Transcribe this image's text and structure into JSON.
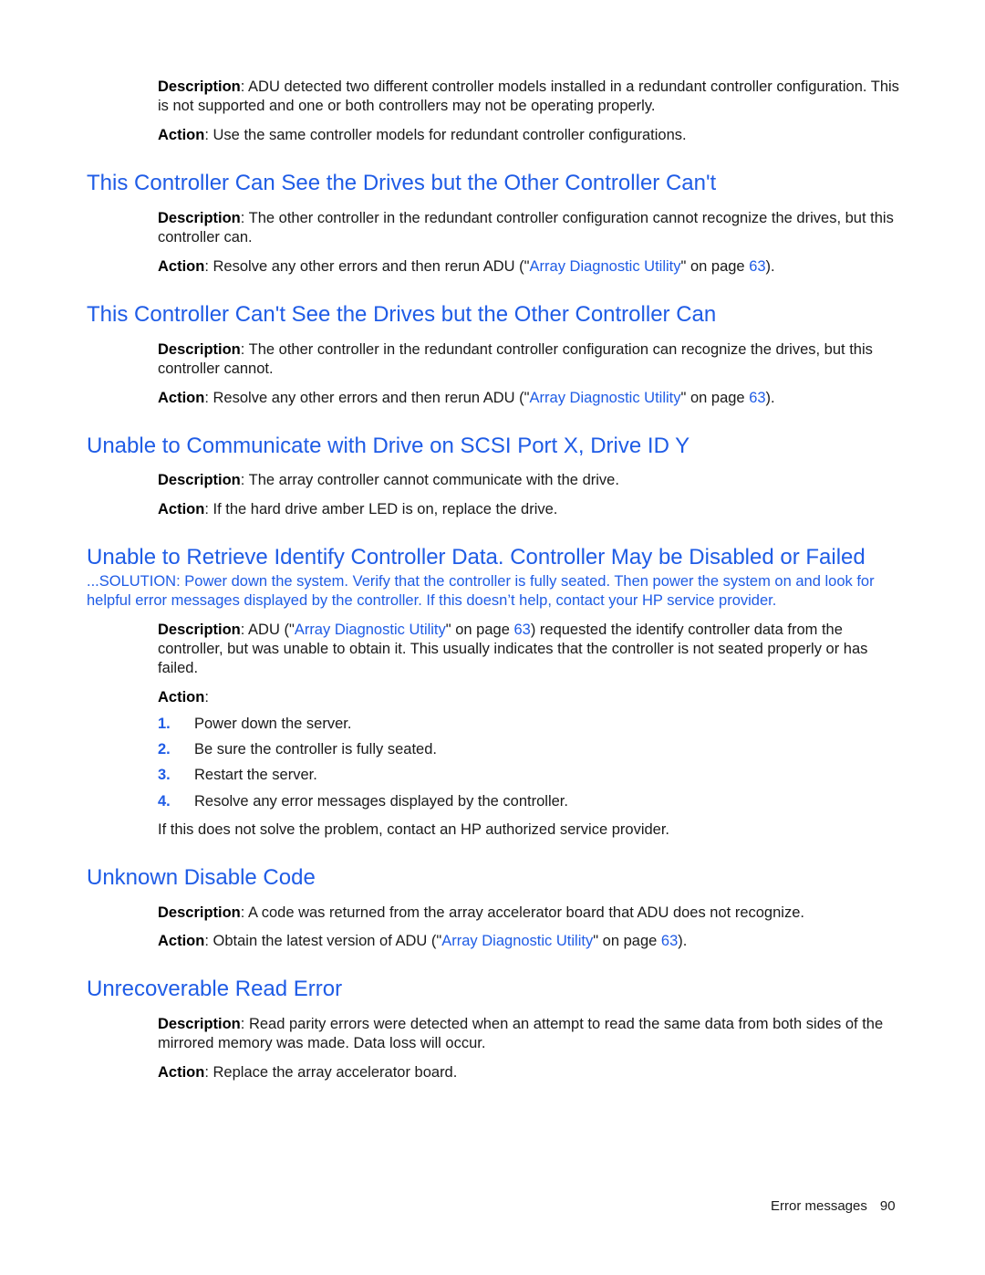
{
  "sections": {
    "s0": {
      "description_label": "Description",
      "description": ": ADU detected two different controller models installed in a redundant controller configuration. This is not supported and one or both controllers may not be operating properly.",
      "action_label": "Action",
      "action": ": Use the same controller models for redundant controller configurations."
    },
    "s1": {
      "title": "This Controller Can See the Drives but the Other Controller Can't",
      "description_label": "Description",
      "description": ": The other controller in the redundant controller configuration cannot recognize the drives, but this controller can.",
      "action_label": "Action",
      "action_pre": ": Resolve any other errors and then rerun ADU (\"",
      "link_text": "Array Diagnostic Utility",
      "action_mid": "\" on page ",
      "page_ref": "63",
      "action_post": ")."
    },
    "s2": {
      "title": "This Controller Can't See the Drives but the Other Controller Can",
      "description_label": "Description",
      "description": ": The other controller in the redundant controller configuration can recognize the drives, but this controller cannot.",
      "action_label": "Action",
      "action_pre": ": Resolve any other errors and then rerun ADU (\"",
      "link_text": "Array Diagnostic Utility",
      "action_mid": "\" on page ",
      "page_ref": "63",
      "action_post": ")."
    },
    "s3": {
      "title": "Unable to Communicate with Drive on SCSI Port X, Drive ID Y",
      "description_label": "Description",
      "description": ": The array controller cannot communicate with the drive.",
      "action_label": "Action",
      "action": ": If the hard drive amber LED is on, replace the drive."
    },
    "s4": {
      "title": "Unable to Retrieve Identify Controller Data. Controller May be Disabled or Failed",
      "solution": "...SOLUTION: Power down the system. Verify that the controller is fully seated. Then power the system on and look for helpful error messages displayed by the controller. If this doesn’t help, contact your HP service provider.",
      "description_label": "Description",
      "desc_pre": ": ADU (\"",
      "link_text": "Array Diagnostic Utility",
      "desc_mid": "\" on page ",
      "page_ref": "63",
      "desc_post": ") requested the identify controller data from the controller, but was unable to obtain it. This usually indicates that the controller is not seated properly or has failed.",
      "action_label": "Action",
      "action_colon": ":",
      "steps": [
        {
          "num": "1.",
          "text": "Power down the server."
        },
        {
          "num": "2.",
          "text": "Be sure the controller is fully seated."
        },
        {
          "num": "3.",
          "text": "Restart the server."
        },
        {
          "num": "4.",
          "text": "Resolve any error messages displayed by the controller."
        }
      ],
      "note": "If this does not solve the problem, contact an HP authorized service provider."
    },
    "s5": {
      "title": "Unknown Disable Code",
      "description_label": "Description",
      "description": ": A code was returned from the array accelerator board that ADU does not recognize.",
      "action_label": "Action",
      "action_pre": ": Obtain the latest version of ADU (\"",
      "link_text": "Array Diagnostic Utility",
      "action_mid": "\" on page ",
      "page_ref": "63",
      "action_post": ")."
    },
    "s6": {
      "title": "Unrecoverable Read Error",
      "description_label": "Description",
      "description": ": Read parity errors were detected when an attempt to read the same data from both sides of the mirrored memory was made. Data loss will occur.",
      "action_label": "Action",
      "action": ": Replace the array accelerator board."
    }
  },
  "footer": {
    "section_name": "Error messages",
    "page_number": "90"
  }
}
